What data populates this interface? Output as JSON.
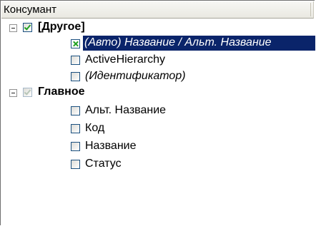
{
  "header": {
    "title": "Консумант"
  },
  "tree": {
    "groups": [
      {
        "label": "[Другое]",
        "expanded": true,
        "checkbox_state": "checked",
        "items": [
          {
            "label": "(Авто) Название / Альт. Название",
            "checkbox_state": "x",
            "selected": true,
            "italic": true
          },
          {
            "label": "ActiveHierarchy",
            "checkbox_state": "unchecked",
            "selected": false,
            "italic": false
          },
          {
            "label": "(Идентификатор)",
            "checkbox_state": "unchecked",
            "selected": false,
            "italic": true
          }
        ]
      },
      {
        "label": "Главное",
        "expanded": true,
        "checkbox_state": "grey",
        "items": [
          {
            "label": "Альт. Название",
            "checkbox_state": "unchecked",
            "selected": false,
            "italic": false
          },
          {
            "label": "Код",
            "checkbox_state": "unchecked",
            "selected": false,
            "italic": false
          },
          {
            "label": "Название",
            "checkbox_state": "unchecked",
            "selected": false,
            "italic": false
          },
          {
            "label": "Статус",
            "checkbox_state": "unchecked",
            "selected": false,
            "italic": false
          }
        ]
      }
    ]
  },
  "colors": {
    "selection_bg": "#0a246a",
    "check_green": "#21a121"
  }
}
